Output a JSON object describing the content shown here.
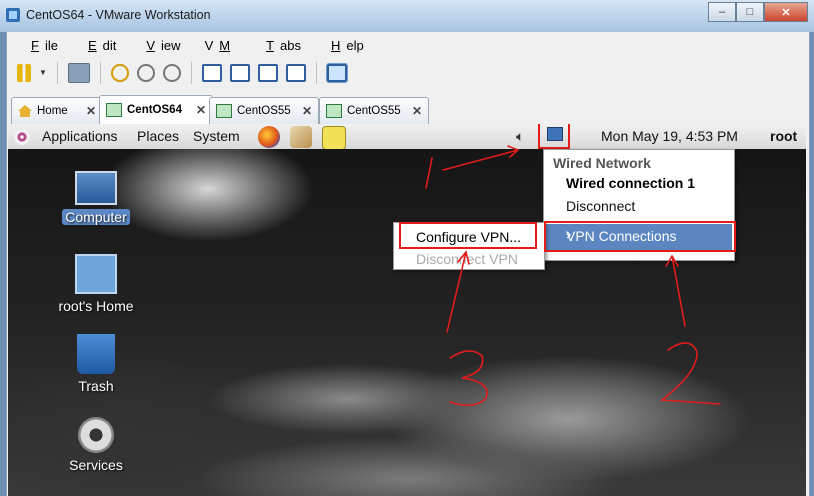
{
  "window": {
    "title": "CentOS64 - VMware Workstation",
    "min": "–",
    "max": "□",
    "close": "✕"
  },
  "menubar": [
    {
      "pre": "",
      "ul": "F",
      "post": "ile"
    },
    {
      "pre": "",
      "ul": "E",
      "post": "dit"
    },
    {
      "pre": "",
      "ul": "V",
      "post": "iew"
    },
    {
      "pre": "V",
      "ul": "M",
      "post": ""
    },
    {
      "pre": "",
      "ul": "T",
      "post": "abs"
    },
    {
      "pre": "",
      "ul": "H",
      "post": "elp"
    }
  ],
  "tabs": [
    {
      "label": "Home",
      "icon": "home-icon"
    },
    {
      "label": "CentOS64",
      "icon": "vm-icon"
    },
    {
      "label": "CentOS55",
      "icon": "vm-icon"
    },
    {
      "label": "CentOS55",
      "icon": "vm-icon"
    }
  ],
  "panel": {
    "applications": "Applications",
    "places": "Places",
    "system": "System",
    "clock": "Mon May 19,  4:53 PM",
    "user": "root"
  },
  "desktop_icons": [
    {
      "label": "Computer"
    },
    {
      "label": "root's Home"
    },
    {
      "label": "Trash"
    },
    {
      "label": "Services"
    }
  ],
  "network_menu": {
    "header": "Wired Network",
    "connection": "Wired connection 1",
    "disconnect": "Disconnect",
    "vpn": "VPN Connections"
  },
  "vpn_submenu": {
    "configure": "Configure VPN...",
    "disconnect": "Disconnect VPN"
  },
  "colors": {
    "annotation": "#e31b1b",
    "selection": "#5c86c0"
  }
}
